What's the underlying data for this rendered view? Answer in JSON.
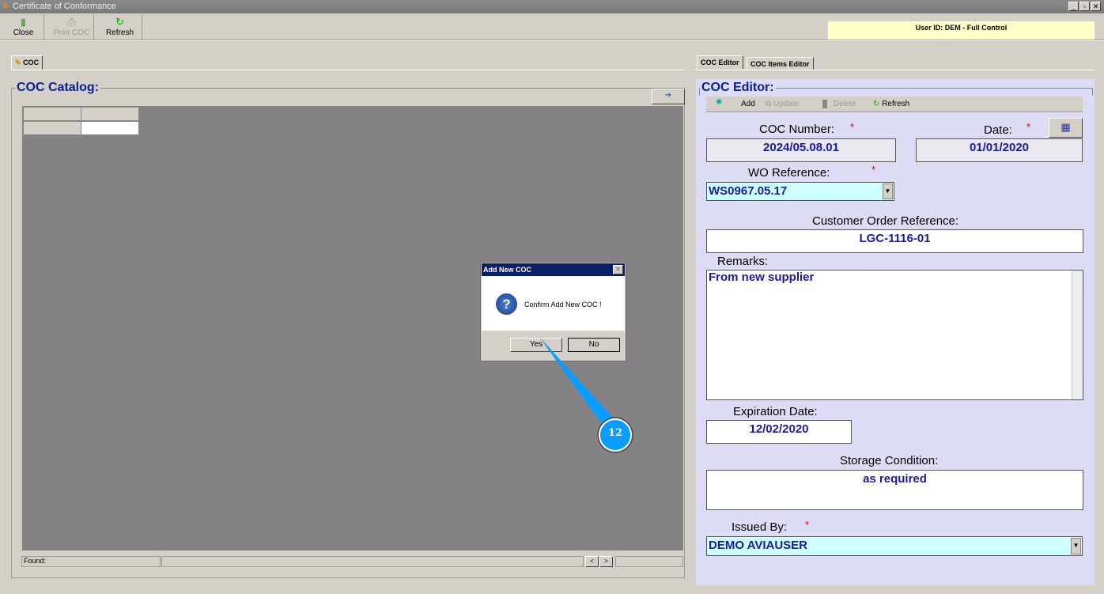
{
  "window": {
    "title": "Certificate of Conformance"
  },
  "toolbar": {
    "close": "Close",
    "print": "Print COC",
    "refresh": "Refresh"
  },
  "user_info": "User ID: DEM - Full Control",
  "left_tab": "COC",
  "catalog": {
    "title": "COC Catalog:",
    "found_label": "Found:",
    "prev": "<",
    "next": ">"
  },
  "right_tabs": [
    "COC Editor",
    "COC Items Editor"
  ],
  "editor": {
    "title": "COC Editor:",
    "toolbar": {
      "add": "Add",
      "update": "Update",
      "delete": "Delete",
      "refresh": "Refresh"
    },
    "required": "*",
    "coc_number_label": "COC Number:",
    "coc_number": "2024/05.08.01",
    "date_label": "Date:",
    "date": "01/01/2020",
    "wo_label": "WO Reference:",
    "wo": "WS0967.05.17",
    "cust_label": "Customer Order Reference:",
    "cust": "LGC-1116-01",
    "remarks_label": "Remarks:",
    "remarks": "From new supplier",
    "exp_label": "Expiration Date:",
    "exp": "12/02/2020",
    "storage_label": "Storage Condition:",
    "storage": "as required",
    "issued_label": "Issued By:",
    "issued": "DEMO AVIAUSER"
  },
  "dialog": {
    "title": "Add New COC",
    "message": "Confirm Add New COC !",
    "yes": "Yes",
    "no": "No"
  },
  "callout": {
    "number": "12",
    "color": "#0a9cff"
  }
}
